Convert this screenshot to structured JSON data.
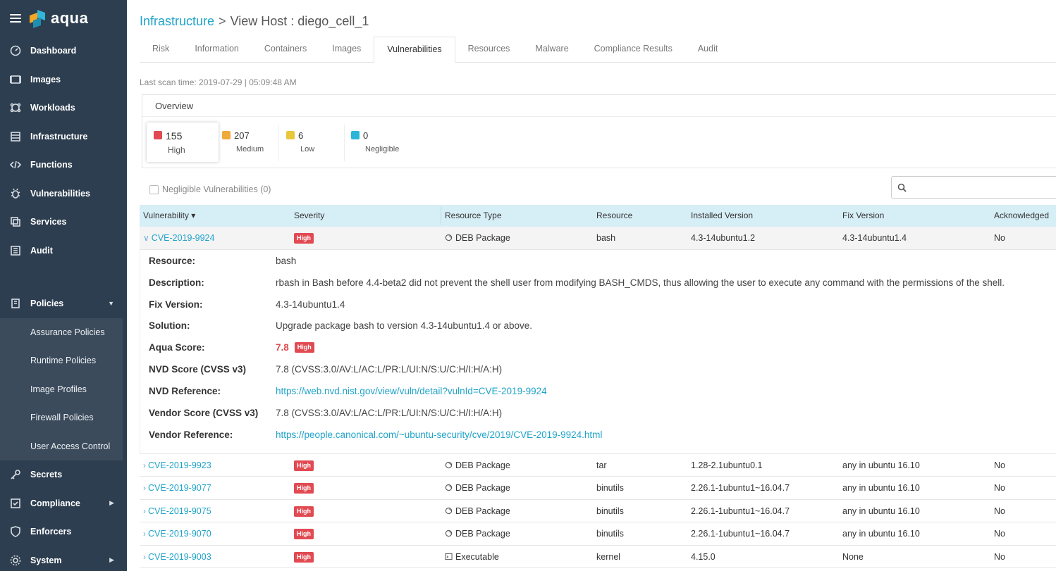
{
  "brand": {
    "name": "aqua"
  },
  "sidebar": {
    "items": [
      {
        "label": "Dashboard",
        "icon": "dashboard-icon"
      },
      {
        "label": "Images",
        "icon": "images-icon"
      },
      {
        "label": "Workloads",
        "icon": "workloads-icon"
      },
      {
        "label": "Infrastructure",
        "icon": "infrastructure-icon"
      },
      {
        "label": "Functions",
        "icon": "code-icon"
      },
      {
        "label": "Vulnerabilities",
        "icon": "bug-icon"
      },
      {
        "label": "Services",
        "icon": "services-icon"
      },
      {
        "label": "Audit",
        "icon": "audit-icon"
      }
    ],
    "policies": {
      "label": "Policies",
      "sub": [
        "Assurance Policies",
        "Runtime Policies",
        "Image Profiles",
        "Firewall Policies",
        "User Access Control"
      ]
    },
    "bottom": [
      {
        "label": "Secrets",
        "icon": "key-icon"
      },
      {
        "label": "Compliance",
        "icon": "compliance-icon"
      },
      {
        "label": "Enforcers",
        "icon": "shield-icon"
      },
      {
        "label": "System",
        "icon": "system-icon"
      }
    ]
  },
  "breadcrumb": {
    "parent": "Infrastructure",
    "separator": ">",
    "current": "View Host : diego_cell_1"
  },
  "tabs": [
    "Risk",
    "Information",
    "Containers",
    "Images",
    "Vulnerabilities",
    "Resources",
    "Malware",
    "Compliance Results",
    "Audit"
  ],
  "scan_time": "Last scan time: 2019-07-29 | 05:09:48 AM",
  "overview": {
    "title": "Overview",
    "severities": [
      {
        "count": "155",
        "label": "High",
        "color": "#e14a52"
      },
      {
        "count": "207",
        "label": "Medium",
        "color": "#f0a93b"
      },
      {
        "count": "6",
        "label": "Low",
        "color": "#e8c73a"
      },
      {
        "count": "0",
        "label": "Negligible",
        "color": "#2cb5d6"
      }
    ]
  },
  "negligible_toggle": "Negligible Vulnerabilities (0)",
  "search": {
    "placeholder": ""
  },
  "table": {
    "columns": [
      "Vulnerability",
      "Severity",
      "Resource Type",
      "Resource",
      "Installed Version",
      "Fix Version",
      "Acknowledged"
    ],
    "sort_indicator": "▾",
    "rows": [
      {
        "cve": "CVE-2019-9924",
        "severity": "High",
        "type": "DEB Package",
        "resource": "bash",
        "installed": "4.3-14ubuntu1.2",
        "fix": "4.3-14ubuntu1.4",
        "ack": "No"
      },
      {
        "cve": "CVE-2019-9923",
        "severity": "High",
        "type": "DEB Package",
        "resource": "tar",
        "installed": "1.28-2.1ubuntu0.1",
        "fix": "any in ubuntu 16.10",
        "ack": "No"
      },
      {
        "cve": "CVE-2019-9077",
        "severity": "High",
        "type": "DEB Package",
        "resource": "binutils",
        "installed": "2.26.1-1ubuntu1~16.04.7",
        "fix": "any in ubuntu 16.10",
        "ack": "No"
      },
      {
        "cve": "CVE-2019-9075",
        "severity": "High",
        "type": "DEB Package",
        "resource": "binutils",
        "installed": "2.26.1-1ubuntu1~16.04.7",
        "fix": "any in ubuntu 16.10",
        "ack": "No"
      },
      {
        "cve": "CVE-2019-9070",
        "severity": "High",
        "type": "DEB Package",
        "resource": "binutils",
        "installed": "2.26.1-1ubuntu1~16.04.7",
        "fix": "any in ubuntu 16.10",
        "ack": "No"
      },
      {
        "cve": "CVE-2019-9003",
        "severity": "High",
        "type": "Executable",
        "resource": "kernel",
        "installed": "4.15.0",
        "fix": "None",
        "ack": "No"
      }
    ]
  },
  "detail": {
    "resource_label": "Resource:",
    "resource": "bash",
    "description_label": "Description:",
    "description": "rbash in Bash before 4.4-beta2 did not prevent the shell user from modifying BASH_CMDS, thus allowing the user to execute any command with the permissions of the shell.",
    "fix_label": "Fix Version:",
    "fix": "4.3-14ubuntu1.4",
    "solution_label": "Solution:",
    "solution": "Upgrade package bash to version 4.3-14ubuntu1.4 or above.",
    "aqua_label": "Aqua Score:",
    "aqua_score": "7.8",
    "aqua_sev": "High",
    "nvd_label": "NVD Score (CVSS v3)",
    "nvd_score": "7.8  (CVSS:3.0/AV:L/AC:L/PR:L/UI:N/S:U/C:H/I:H/A:H)",
    "nvd_ref_label": "NVD Reference:",
    "nvd_ref": "https://web.nvd.nist.gov/view/vuln/detail?vulnId=CVE-2019-9924",
    "vendor_label": "Vendor Score (CVSS v3)",
    "vendor_score": "7.8  (CVSS:3.0/AV:L/AC:L/PR:L/UI:N/S:U/C:H/I:H/A:H)",
    "vendor_ref_label": "Vendor Reference:",
    "vendor_ref": "https://people.canonical.com/~ubuntu-security/cve/2019/CVE-2019-9924.html"
  },
  "colors": {
    "sidebar": "#2d3e50",
    "accent": "#1fa3c9",
    "high": "#e14a52",
    "header_row": "#d6eef6"
  }
}
